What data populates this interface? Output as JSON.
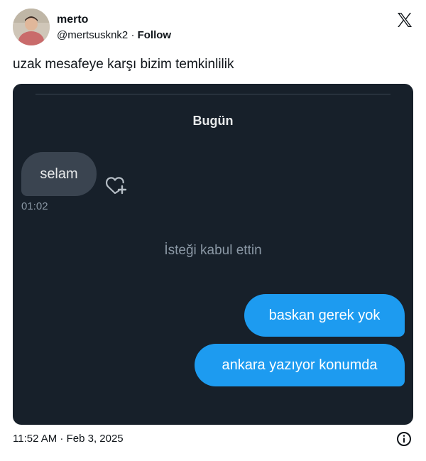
{
  "author": {
    "display_name": "merto",
    "handle": "@mertsusknk2",
    "separator": "·",
    "follow_label": "Follow"
  },
  "tweet": {
    "text": "uzak mesafeye karşı bizim temkinlilik",
    "timestamp": "11:52 AM · Feb 3, 2025"
  },
  "chat": {
    "day_label": "Bugün",
    "incoming": {
      "text": "selam",
      "time": "01:02"
    },
    "system_message": "İsteği kabul ettin",
    "outgoing": [
      {
        "text": "baskan gerek yok"
      },
      {
        "text": "ankara yazıyor konumda"
      }
    ]
  },
  "colors": {
    "accent": "#1d9bf0",
    "chat_background": "#17202a",
    "incoming_bubble": "#3a4450",
    "muted_text": "#8b98a5"
  },
  "icons": {
    "logo": "x-logo-icon",
    "react": "heart-plus-icon",
    "info": "info-icon"
  }
}
